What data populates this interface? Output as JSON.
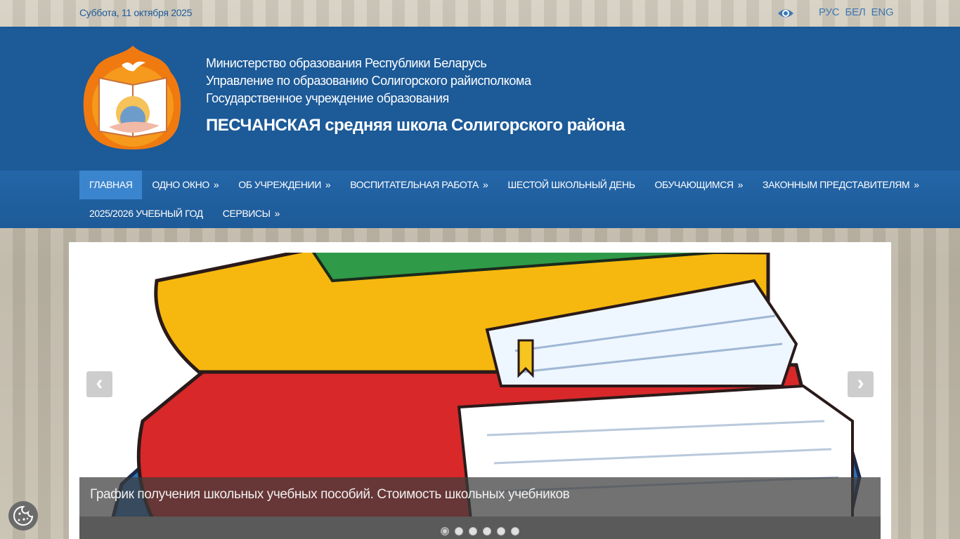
{
  "topbar": {
    "date": "Суббота, 11 октября 2025",
    "languages": [
      "РУС",
      "БЕЛ",
      "ENG"
    ]
  },
  "header": {
    "line1": "Министерство образования Республики Беларусь",
    "line2": "Управление по образованию Солигорского райисполкома",
    "line3": "Государственное учреждение образования",
    "title": "ПЕСЧАНСКАЯ средняя школа Солигорского района"
  },
  "nav": {
    "row1": [
      {
        "label": "ГЛАВНАЯ",
        "arrow": ""
      },
      {
        "label": "ОДНО ОКНО",
        "arrow": "»"
      },
      {
        "label": "ОБ УЧРЕЖДЕНИИ",
        "arrow": "»"
      },
      {
        "label": "ВОСПИТАТЕЛЬНАЯ РАБОТА",
        "arrow": "»"
      },
      {
        "label": "ШЕСТОЙ ШКОЛЬНЫЙ ДЕНЬ",
        "arrow": ""
      },
      {
        "label": "ОБУЧАЮЩИМСЯ",
        "arrow": "»"
      },
      {
        "label": "ЗАКОННЫМ ПРЕДСТАВИТЕЛЯМ",
        "arrow": "»"
      }
    ],
    "row2": [
      {
        "label": "2025/2026 УЧЕБНЫЙ ГОД",
        "arrow": ""
      },
      {
        "label": "СЕРВИСЫ",
        "arrow": "»"
      }
    ]
  },
  "slider": {
    "caption": "График получения школьных учебных пособий. Стоимость школьных учебников",
    "dot_count": 6,
    "active_dot": 1,
    "prev": "‹",
    "next": "›"
  },
  "colors": {
    "header_bg": "#1c5a98",
    "nav_active": "#3b85cf",
    "date_text": "#1e5a9a"
  }
}
